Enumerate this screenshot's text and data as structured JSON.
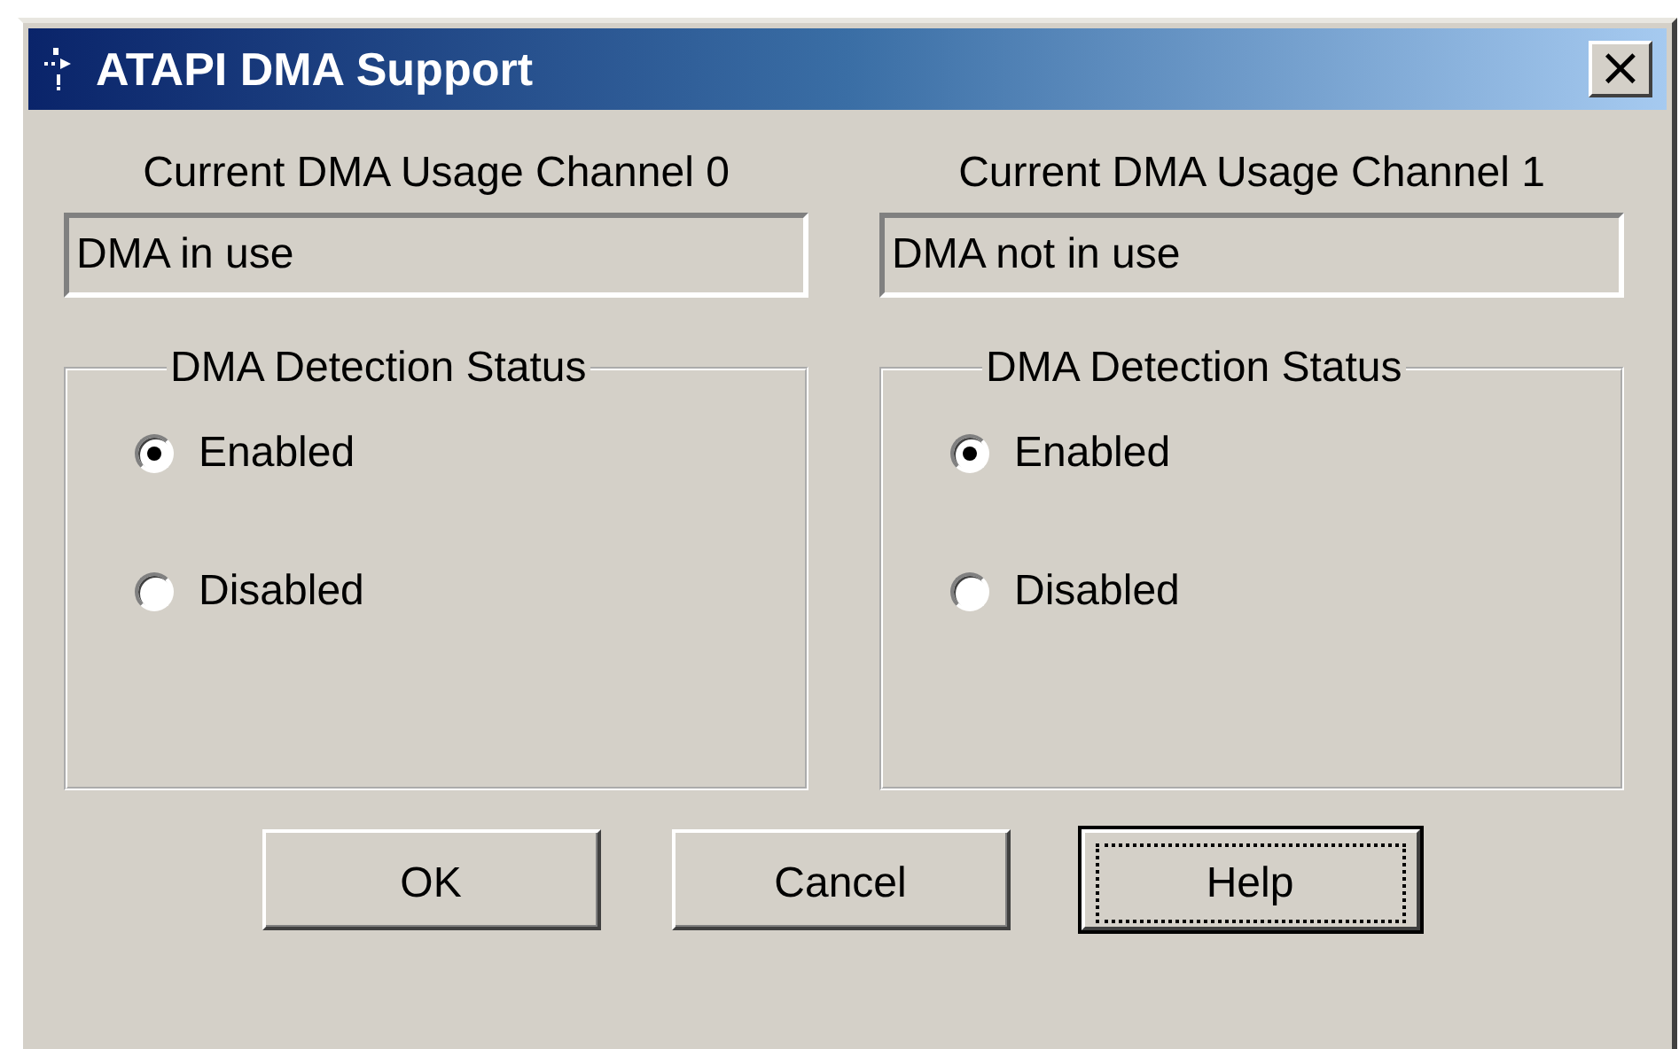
{
  "window": {
    "title": "ATAPI DMA Support",
    "close_label": "×"
  },
  "channels": [
    {
      "label": "Current DMA Usage Channel 0",
      "value": "DMA in use",
      "group_title": "DMA Detection Status",
      "options": [
        {
          "label": "Enabled",
          "selected": true
        },
        {
          "label": "Disabled",
          "selected": false
        }
      ]
    },
    {
      "label": "Current DMA Usage Channel 1",
      "value": "DMA not in use",
      "group_title": "DMA Detection Status",
      "options": [
        {
          "label": "Enabled",
          "selected": true
        },
        {
          "label": "Disabled",
          "selected": false
        }
      ]
    }
  ],
  "buttons": [
    {
      "label": "OK",
      "focused": false
    },
    {
      "label": "Cancel",
      "focused": false
    },
    {
      "label": "Help",
      "focused": true
    }
  ]
}
